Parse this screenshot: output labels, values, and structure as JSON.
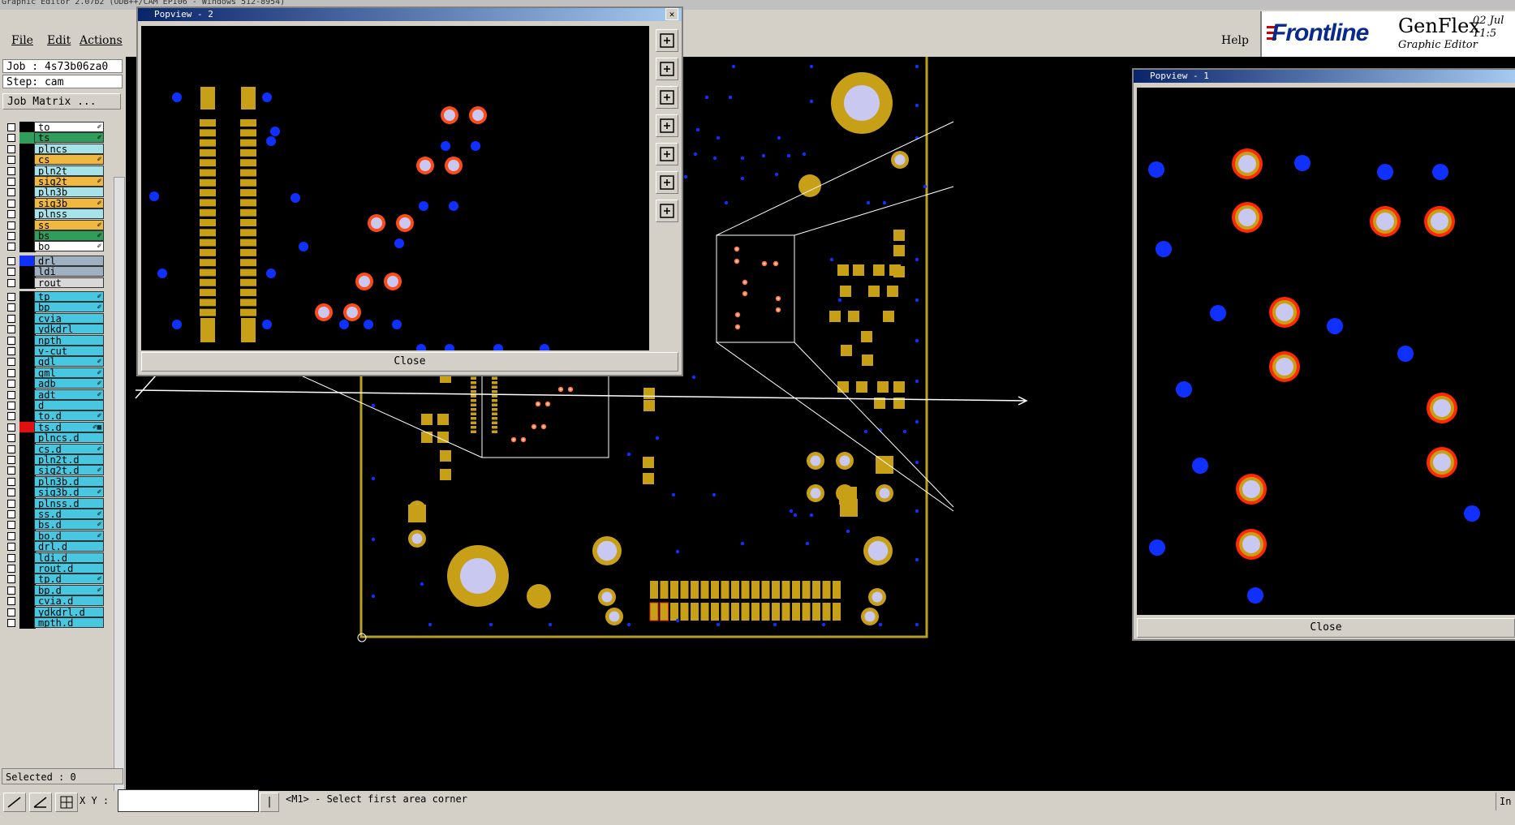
{
  "app": {
    "title": "Graphic Editor 2.07b2 (ODB++/CAM EPI06 - Windows 512-8954)"
  },
  "menu": {
    "file": "File",
    "edit": "Edit",
    "actions": "Actions",
    "help": "Help"
  },
  "brand": {
    "logo": "Frontline",
    "product": "GenFlex",
    "subtitle": "Graphic Editor",
    "date": "02 Jul",
    "time": "11:5"
  },
  "job": {
    "job_label": "Job : 4s73b06za0",
    "step_label": "Step: cam",
    "matrix_button": "Job Matrix ..."
  },
  "layers": [
    {
      "name": "to",
      "color": "#ffffff",
      "swatch": "#000000",
      "flag": "✐"
    },
    {
      "name": "ts",
      "color": "#2e9e5a",
      "swatch": "#2e9e5a",
      "flag": "✐"
    },
    {
      "name": "plncs",
      "color": "#a6e3e8",
      "swatch": "#000000",
      "flag": ""
    },
    {
      "name": "cs",
      "color": "#f0b840",
      "swatch": "#000000",
      "flag": "✐"
    },
    {
      "name": "pln2t",
      "color": "#a6e3e8",
      "swatch": "#000000",
      "flag": ""
    },
    {
      "name": "sig2t",
      "color": "#f0b840",
      "swatch": "#000000",
      "flag": "✐"
    },
    {
      "name": "pln3b",
      "color": "#a6e3e8",
      "swatch": "#000000",
      "flag": ""
    },
    {
      "name": "sig3b",
      "color": "#f0b840",
      "swatch": "#000000",
      "flag": "✐"
    },
    {
      "name": "plnss",
      "color": "#a6e3e8",
      "swatch": "#000000",
      "flag": ""
    },
    {
      "name": "ss",
      "color": "#f0b840",
      "swatch": "#000000",
      "flag": "✐"
    },
    {
      "name": "bs",
      "color": "#2e9e5a",
      "swatch": "#000000",
      "flag": "✐"
    },
    {
      "name": "bo",
      "color": "#ffffff",
      "swatch": "#000000",
      "flag": "✐"
    },
    {
      "name": "drl",
      "color": "#9fb0c0",
      "swatch": "#1030ff",
      "flag": ""
    },
    {
      "name": "ldi",
      "color": "#9fb0c0",
      "swatch": "#000000",
      "flag": ""
    },
    {
      "name": "rout",
      "color": "#d8d8d8",
      "swatch": "#000000",
      "flag": ""
    },
    {
      "name": "tp",
      "color": "#48c8e0",
      "swatch": "#000000",
      "flag": "✐"
    },
    {
      "name": "bp",
      "color": "#48c8e0",
      "swatch": "#000000",
      "flag": "✐"
    },
    {
      "name": "cvia",
      "color": "#48c8e0",
      "swatch": "#000000",
      "flag": ""
    },
    {
      "name": "ydkdrl",
      "color": "#48c8e0",
      "swatch": "#000000",
      "flag": ""
    },
    {
      "name": "npth",
      "color": "#48c8e0",
      "swatch": "#000000",
      "flag": ""
    },
    {
      "name": "v-cut",
      "color": "#48c8e0",
      "swatch": "#000000",
      "flag": ""
    },
    {
      "name": "gdl",
      "color": "#48c8e0",
      "swatch": "#000000",
      "flag": "✐"
    },
    {
      "name": "gml",
      "color": "#48c8e0",
      "swatch": "#000000",
      "flag": "✐"
    },
    {
      "name": "adb",
      "color": "#48c8e0",
      "swatch": "#000000",
      "flag": "✐"
    },
    {
      "name": "adt",
      "color": "#48c8e0",
      "swatch": "#000000",
      "flag": "✐"
    },
    {
      "name": "d",
      "color": "#48c8e0",
      "swatch": "#000000",
      "flag": ""
    },
    {
      "name": "to.d",
      "color": "#48c8e0",
      "swatch": "#000000",
      "flag": "✐"
    },
    {
      "name": "ts.d",
      "color": "#48c8e0",
      "swatch": "#e01010",
      "flag": "✐▦"
    },
    {
      "name": "plncs.d",
      "color": "#48c8e0",
      "swatch": "#000000",
      "flag": ""
    },
    {
      "name": "cs.d",
      "color": "#48c8e0",
      "swatch": "#000000",
      "flag": "✐"
    },
    {
      "name": "pln2t.d",
      "color": "#48c8e0",
      "swatch": "#000000",
      "flag": ""
    },
    {
      "name": "sig2t.d",
      "color": "#48c8e0",
      "swatch": "#000000",
      "flag": "✐"
    },
    {
      "name": "pln3b.d",
      "color": "#48c8e0",
      "swatch": "#000000",
      "flag": ""
    },
    {
      "name": "sig3b.d",
      "color": "#48c8e0",
      "swatch": "#000000",
      "flag": "✐"
    },
    {
      "name": "plnss.d",
      "color": "#48c8e0",
      "swatch": "#000000",
      "flag": ""
    },
    {
      "name": "ss.d",
      "color": "#48c8e0",
      "swatch": "#000000",
      "flag": "✐"
    },
    {
      "name": "bs.d",
      "color": "#48c8e0",
      "swatch": "#000000",
      "flag": "✐"
    },
    {
      "name": "bo.d",
      "color": "#48c8e0",
      "swatch": "#000000",
      "flag": "✐"
    },
    {
      "name": "drl.d",
      "color": "#48c8e0",
      "swatch": "#000000",
      "flag": ""
    },
    {
      "name": "ldi.d",
      "color": "#48c8e0",
      "swatch": "#000000",
      "flag": ""
    },
    {
      "name": "rout.d",
      "color": "#48c8e0",
      "swatch": "#000000",
      "flag": ""
    },
    {
      "name": "tp.d",
      "color": "#48c8e0",
      "swatch": "#000000",
      "flag": "✐"
    },
    {
      "name": "bp.d",
      "color": "#48c8e0",
      "swatch": "#000000",
      "flag": "✐"
    },
    {
      "name": "cvia.d",
      "color": "#48c8e0",
      "swatch": "#000000",
      "flag": ""
    },
    {
      "name": "ydkdrl.d",
      "color": "#48c8e0",
      "swatch": "#000000",
      "flag": ""
    },
    {
      "name": "mpth.d",
      "color": "#48c8e0",
      "swatch": "#000000",
      "flag": ""
    }
  ],
  "selected": "Selected : 0",
  "status": {
    "xy_label": "X Y :",
    "xy_value": "",
    "message": "<M1> - Select first area corner",
    "right_text": "In"
  },
  "popview2": {
    "title": "Popview - 2",
    "close": "Close"
  },
  "popview1": {
    "title": "Popview - 1",
    "close": "Close"
  },
  "colors": {
    "pad": "#c8a018",
    "via": "#1030ff",
    "hole": "#c8c8f0",
    "board_outline": "#b8a020",
    "highlight": "#ff2a00"
  }
}
